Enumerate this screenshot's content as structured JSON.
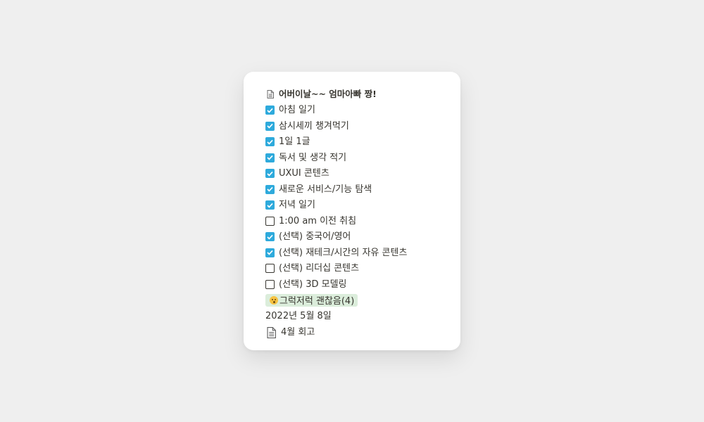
{
  "card": {
    "title": "어버이날~~ 엄마아빠 짱!",
    "title_icon": "page-icon",
    "items": [
      {
        "label": "아침 일기",
        "checked": true
      },
      {
        "label": "삼시세끼 챙겨먹기",
        "checked": true
      },
      {
        "label": "1일 1글",
        "checked": true
      },
      {
        "label": "독서 및 생각 적기",
        "checked": true
      },
      {
        "label": "UXUI 콘텐츠",
        "checked": true
      },
      {
        "label": "새로운 서비스/기능 탐색",
        "checked": true
      },
      {
        "label": "저녁 일기",
        "checked": true
      },
      {
        "label": "1:00 am 이전 취침",
        "checked": false
      },
      {
        "label": "(선택) 중국어/영어",
        "checked": true
      },
      {
        "label": "(선택) 재테크/시간의 자유 콘텐츠",
        "checked": true
      },
      {
        "label": "(선택) 리더십 콘텐츠",
        "checked": false
      },
      {
        "label": "(선택) 3D 모델링",
        "checked": false
      }
    ],
    "tag": {
      "emoji": "face-emoji",
      "label": "그럭저럭 괜찮음(4)",
      "color": "#dbeddb"
    },
    "date": "2022년 5월 8일",
    "link": {
      "icon": "page-icon",
      "label": "4월 회고"
    }
  },
  "colors": {
    "checkbox_checked": "#2eaadc",
    "background": "#efefef",
    "card": "#ffffff",
    "text": "#37352f"
  }
}
